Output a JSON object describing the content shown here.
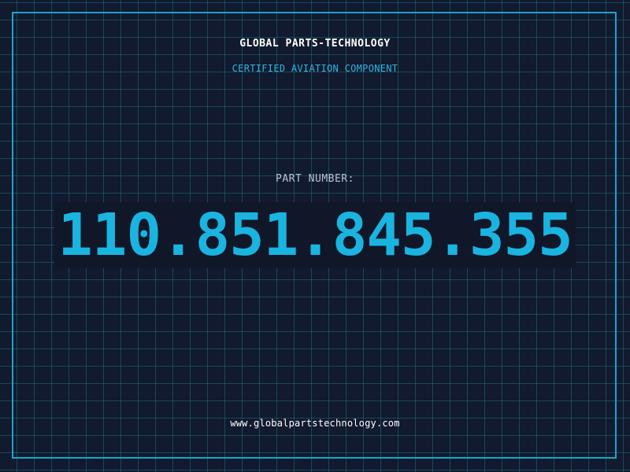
{
  "header": {
    "brand": "GLOBAL PARTS-TECHNOLOGY",
    "subtitle": "CERTIFIED AVIATION COMPONENT"
  },
  "part": {
    "label": "PART NUMBER:",
    "number": "110.851.845.355"
  },
  "footer": {
    "url": "www.globalpartstechnology.com"
  },
  "colors": {
    "background": "#111a2e",
    "grid": "#1e6e82",
    "accent": "#1ab4e0",
    "text": "#ffffff",
    "label": "#b8c4d4"
  }
}
